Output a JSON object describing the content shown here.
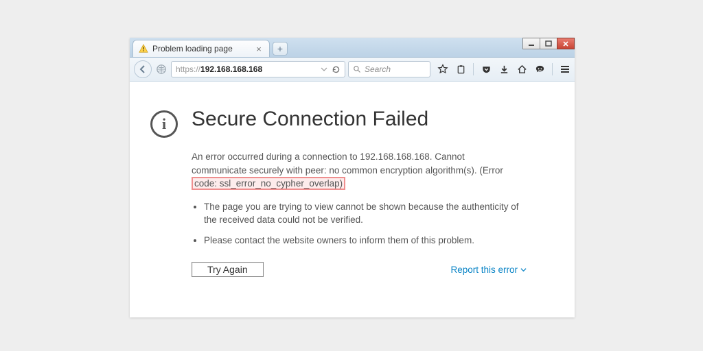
{
  "tab": {
    "title": "Problem loading page"
  },
  "url": {
    "protocol": "https://",
    "host": "192.168.168.168"
  },
  "search": {
    "placeholder": "Search"
  },
  "error": {
    "title": "Secure Connection Failed",
    "para_pre": "An error occurred during a connection to 192.168.168.168. Cannot communicate securely with peer: no common encryption algorithm(s). (Error ",
    "para_code": "code: ssl_error_no_cypher_overlap)",
    "bullets": [
      "The page you are trying to view cannot be shown because the authenticity of the received data could not be verified.",
      "Please contact the website owners to inform them of this problem."
    ],
    "try_again": "Try Again",
    "report": "Report this error"
  }
}
